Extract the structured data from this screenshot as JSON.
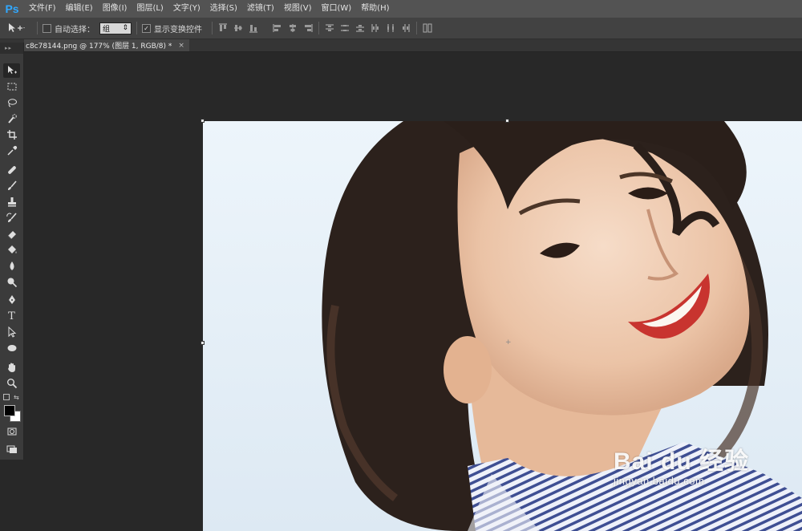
{
  "app": {
    "logo": "Ps"
  },
  "menu": [
    "文件(F)",
    "编辑(E)",
    "图像(I)",
    "图层(L)",
    "文字(Y)",
    "选择(S)",
    "滤镜(T)",
    "视图(V)",
    "窗口(W)",
    "帮助(H)"
  ],
  "options": {
    "auto_select_label": "自动选择：",
    "auto_select_checked": false,
    "auto_select_value": "组",
    "show_transform_label": "显示变换控件",
    "show_transform_checked": true
  },
  "document_tab": {
    "title": "c8c78144.png @ 177% (图层 1, RGB/8) *",
    "close": "×"
  },
  "toolbox": {
    "grip": "▸▸",
    "tools": [
      "move-tool-icon",
      "marquee-tool-icon",
      "lasso-tool-icon",
      "quick-selection-tool-icon",
      "crop-tool-icon",
      "eyedropper-tool-icon",
      "spot-healing-brush-icon",
      "brush-tool-icon",
      "clone-stamp-icon",
      "history-brush-icon",
      "eraser-tool-icon",
      "paint-bucket-icon",
      "blur-tool-icon",
      "dodge-tool-icon",
      "pen-tool-icon",
      "type-tool-icon",
      "path-selection-icon",
      "ellipse-tool-icon",
      "hand-tool-icon",
      "zoom-tool-icon",
      "quick-mask-icon",
      "screen-mode-icon"
    ],
    "type_glyph": "T",
    "swap_glyph": "⇆",
    "foreground_color": "#000000",
    "background_color": "#ffffff"
  },
  "watermark": {
    "main": "Bai du 经验",
    "sub": "jingyan.baidu.com"
  },
  "colors": {
    "menubar": "#535353",
    "optionsbar": "#424242",
    "workspace": "#282828",
    "accent": "#31a8ff"
  }
}
